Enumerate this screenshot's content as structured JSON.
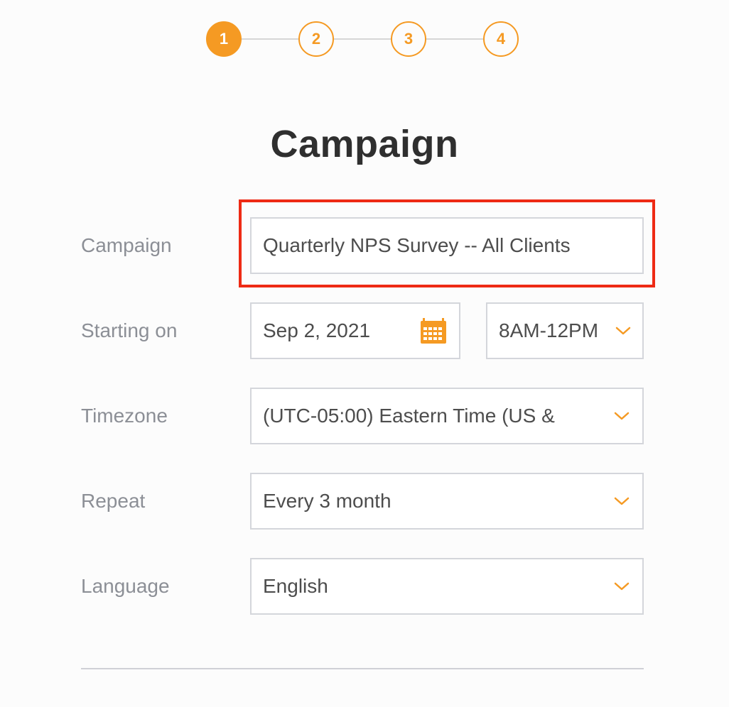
{
  "stepper": {
    "steps": [
      "1",
      "2",
      "3",
      "4"
    ],
    "active_step": "1",
    "accent_color": "#f59a23"
  },
  "title": "Campaign",
  "form": {
    "campaign": {
      "label": "Campaign",
      "value": "Quarterly NPS Survey -- All Clients"
    },
    "starting_on": {
      "label": "Starting on",
      "date": "Sep 2, 2021",
      "date_icon": "calendar-icon",
      "time_window": "8AM-12PM"
    },
    "timezone": {
      "label": "Timezone",
      "value": "(UTC-05:00) Eastern Time (US &"
    },
    "repeat": {
      "label": "Repeat",
      "value": "Every 3 month"
    },
    "language": {
      "label": "Language",
      "value": "English"
    }
  },
  "annotation": {
    "highlight_color": "#ee2a14"
  }
}
